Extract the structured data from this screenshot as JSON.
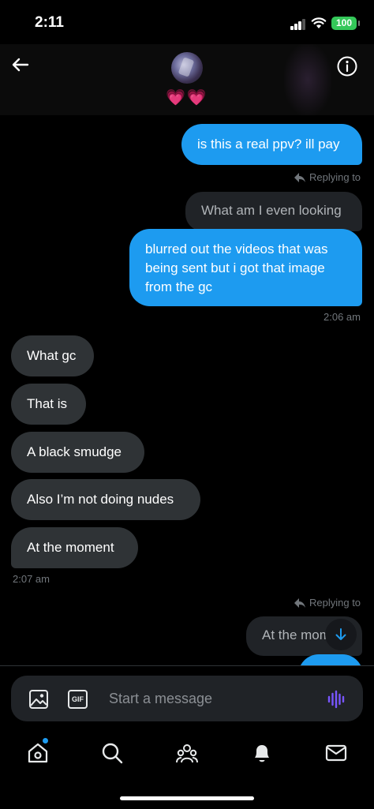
{
  "status_bar": {
    "time": "2:11",
    "battery": "100"
  },
  "header": {
    "hearts": "💗💗"
  },
  "messages": [
    {
      "id": "m1",
      "type": "sent",
      "text": "is this a real ppv? ill pay"
    },
    {
      "id": "m2",
      "type": "reply_tag",
      "text": "Replying to"
    },
    {
      "id": "m3",
      "type": "quoted",
      "text": "What am I even looking at"
    },
    {
      "id": "m4",
      "type": "sent",
      "lines": [
        "blurred out the videos that was",
        "being sent but i got that image",
        "from the gc"
      ]
    },
    {
      "id": "m5",
      "type": "time",
      "text": "2:06 am"
    },
    {
      "id": "m6",
      "type": "received",
      "text": "What gc"
    },
    {
      "id": "m7",
      "type": "received",
      "text": "That is"
    },
    {
      "id": "m8",
      "type": "received",
      "text": "A black smudge"
    },
    {
      "id": "m9",
      "type": "received",
      "text": "Also I’m not doing nudes"
    },
    {
      "id": "m10",
      "type": "received",
      "text": "At the moment"
    },
    {
      "id": "m11",
      "type": "time",
      "text": "2:07 am"
    },
    {
      "id": "m12",
      "type": "reply_tag",
      "text": "Replying to"
    },
    {
      "id": "m13",
      "type": "quoted",
      "text": "At the mom"
    }
  ],
  "composer": {
    "placeholder": "Start a message",
    "gif_label": "GIF"
  },
  "nav": [
    "home",
    "search",
    "communities",
    "notifications",
    "messages"
  ],
  "colors": {
    "accent": "#1d9bf0",
    "received_bubble": "#2f3336",
    "battery": "#34c759",
    "voice": "#7856ff"
  }
}
